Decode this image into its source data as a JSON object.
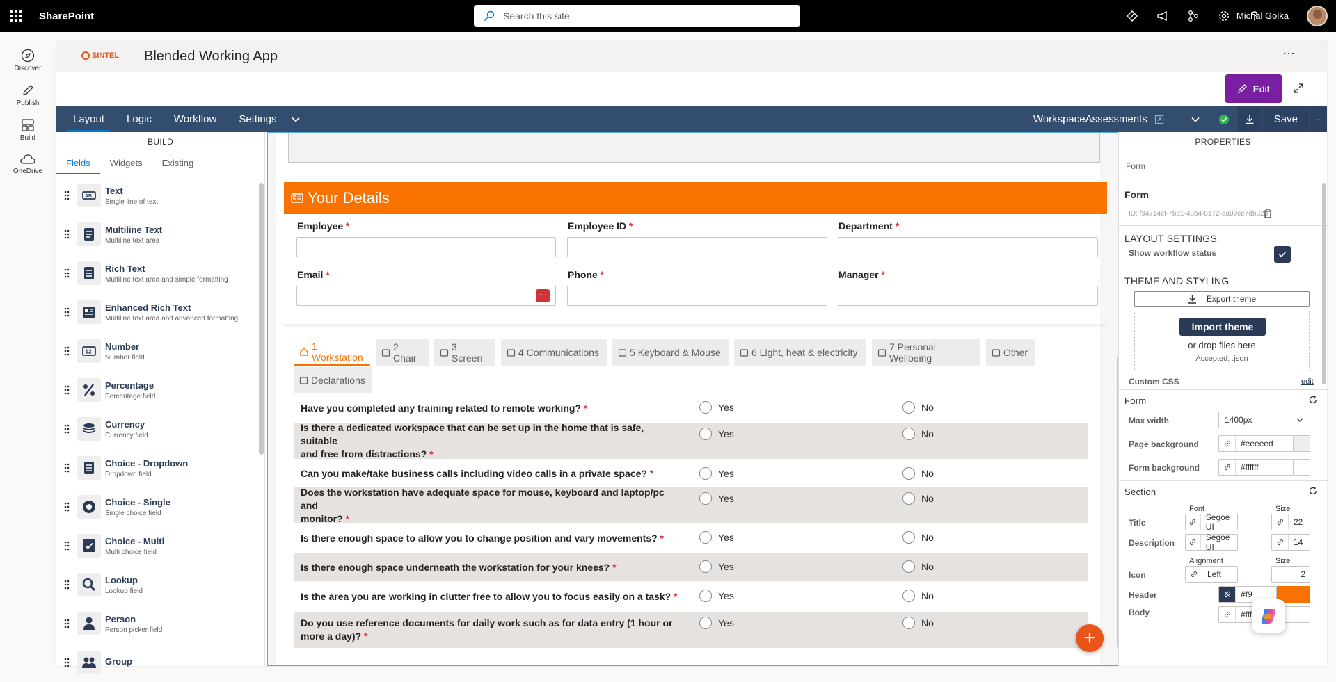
{
  "topbar": {
    "brand": "SharePoint",
    "search_placeholder": "Search this site",
    "user_name": "Michal Golka"
  },
  "rail": [
    {
      "label": "Discover",
      "icon": "compass-icon"
    },
    {
      "label": "Publish",
      "icon": "pen-icon"
    },
    {
      "label": "Build",
      "icon": "build-icon"
    },
    {
      "label": "OneDrive",
      "icon": "cloud-icon"
    }
  ],
  "app": {
    "logo_text": "SINTEL",
    "title": "Blended Working App",
    "edit_label": "Edit"
  },
  "nav": {
    "tabs": [
      "Layout",
      "Logic",
      "Workflow",
      "Settings"
    ],
    "workspace": "WorkspaceAssessments",
    "save_label": "Save"
  },
  "build": {
    "title": "BUILD",
    "tabs": [
      "Fields",
      "Widgets",
      "Existing"
    ],
    "fields": [
      {
        "name": "Text",
        "desc": "Single line of text",
        "icon": "text-field-icon"
      },
      {
        "name": "Multiline Text",
        "desc": "Multiline text area",
        "icon": "multiline-icon"
      },
      {
        "name": "Rich Text",
        "desc": "Multiline text area and simple formatting",
        "icon": "rich-text-icon"
      },
      {
        "name": "Enhanced Rich Text",
        "desc": "Multiline text area and advanced formatting",
        "icon": "enhanced-rich-text-icon"
      },
      {
        "name": "Number",
        "desc": "Number field",
        "icon": "number-icon"
      },
      {
        "name": "Percentage",
        "desc": "Percentage field",
        "icon": "percent-icon"
      },
      {
        "name": "Currency",
        "desc": "Currency field",
        "icon": "coins-icon"
      },
      {
        "name": "Choice - Dropdown",
        "desc": "Dropdown field",
        "icon": "dropdown-icon"
      },
      {
        "name": "Choice - Single",
        "desc": "Single choice field",
        "icon": "radio-icon"
      },
      {
        "name": "Choice - Multi",
        "desc": "Multi choice field",
        "icon": "checkbox-icon"
      },
      {
        "name": "Lookup",
        "desc": "Lookup field",
        "icon": "magnifier-icon"
      },
      {
        "name": "Person",
        "desc": "Person picker field",
        "icon": "person-icon"
      },
      {
        "name": "Group",
        "desc": "",
        "icon": "group-icon"
      }
    ]
  },
  "form": {
    "section_title": "Your Details",
    "fields": [
      {
        "label": "Employee",
        "required": "*"
      },
      {
        "label": "Employee ID",
        "required": "*"
      },
      {
        "label": "Department",
        "required": "*"
      },
      {
        "label": "Email",
        "required": "*"
      },
      {
        "label": "Phone",
        "required": "*"
      },
      {
        "label": "Manager",
        "required": "*"
      }
    ],
    "tabs": [
      {
        "label": "1 Workstation",
        "icon": "home-icon"
      },
      {
        "label": "2 Chair",
        "icon": "chair-icon"
      },
      {
        "label": "3 Screen",
        "icon": "monitor-icon"
      },
      {
        "label": "4 Communications",
        "icon": "headset-icon"
      },
      {
        "label": "5 Keyboard & Mouse",
        "icon": "keyboard-icon"
      },
      {
        "label": "6 Light, heat & electricity",
        "icon": "lamp-icon"
      },
      {
        "label": "7 Personal Wellbeing",
        "icon": "brain-icon"
      },
      {
        "label": "Other",
        "icon": "lightbulb-icon"
      },
      {
        "label": "Declarations",
        "icon": "signature-icon"
      }
    ],
    "yes_label": "Yes",
    "no_label": "No",
    "questions": [
      {
        "line1": "Have you completed any training related to remote working?",
        "line2": ""
      },
      {
        "line1": "Is there a dedicated workspace that can be set up in the home that is safe, suitable",
        "line2": "and free from distractions?"
      },
      {
        "line1": "Can you make/take business calls including video calls in a private space?",
        "line2": ""
      },
      {
        "line1": "Does the workstation have adequate space for mouse, keyboard and laptop/pc and",
        "line2": "monitor?"
      },
      {
        "line1": "Is there enough space to allow you to change position and vary movements?",
        "line2": ""
      },
      {
        "line1": "Is there enough space underneath the workstation for your knees?",
        "line2": ""
      },
      {
        "line1": "Is the area you are working in clutter free to allow you to focus easily on a task?",
        "line2": ""
      },
      {
        "line1": "Do you use reference documents for daily work such as for data entry (1 hour or",
        "line2": "more a day)?"
      }
    ]
  },
  "props": {
    "title": "PROPERTIES",
    "breadcrumb": "Form",
    "heading": "Form",
    "id_text": "ID: f94714cf-7bd1-48b4-8172-aa09ce7db323",
    "layout_settings": "LAYOUT SETTINGS",
    "show_workflow": "Show workflow status",
    "theme_styling": "THEME AND STYLING",
    "export_theme": "Export theme",
    "import_theme": "Import theme",
    "drop_files": "or drop files here",
    "accepted": "Accepted: .json",
    "custom_css": "Custom CSS",
    "edit_link": "edit",
    "form_label": "Form",
    "max_width_label": "Max width",
    "max_width_value": "1400px",
    "page_bg_label": "Page background",
    "page_bg_value": "#eeeeed",
    "form_bg_label": "Form background",
    "form_bg_value": "#ffffff",
    "section_label": "Section",
    "font_col": "Font",
    "size_col": "Size",
    "alignment_col": "Alignment",
    "title_label": "Title",
    "title_font": "Segoe UI",
    "title_size": "22",
    "desc_label": "Description",
    "desc_font": "Segoe UI",
    "desc_size": "14",
    "icon_label": "Icon",
    "icon_align": "Left",
    "icon_size": "2",
    "header_label": "Header",
    "header_value": "#f9",
    "body_label": "Body",
    "body_value": "#ffffff"
  },
  "colors": {
    "accent_orange": "#f97200",
    "nav_blue": "#334d6e",
    "edit_purple": "#7b1fa2",
    "page_bg_swatch": "#eeeeed",
    "header_swatch": "#f97200"
  }
}
